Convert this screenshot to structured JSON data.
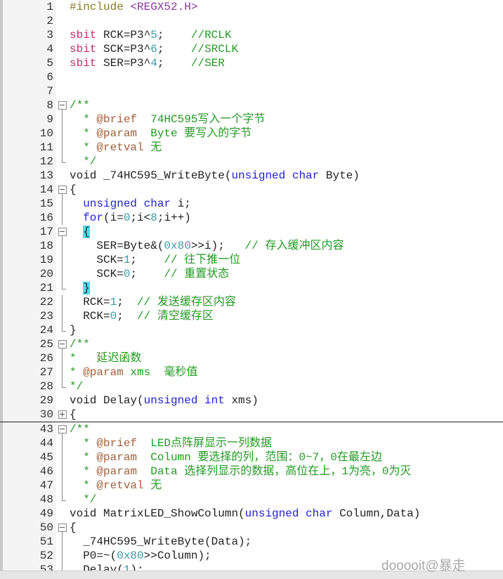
{
  "editor": {
    "lines": [
      {
        "n": "1",
        "fold": "none",
        "tokens": [
          [
            "p",
            "#include "
          ],
          [
            "str",
            "<REGX52.H>"
          ]
        ]
      },
      {
        "n": "2",
        "fold": "none",
        "tokens": []
      },
      {
        "n": "3",
        "fold": "none",
        "tokens": [
          [
            "s",
            "sbit "
          ],
          [
            "t",
            "RCK=P3^"
          ],
          [
            "n",
            "5"
          ],
          [
            "t",
            ";    "
          ],
          [
            "c",
            "//RCLK"
          ]
        ]
      },
      {
        "n": "4",
        "fold": "none",
        "tokens": [
          [
            "s",
            "sbit "
          ],
          [
            "t",
            "SCK=P3^"
          ],
          [
            "n",
            "6"
          ],
          [
            "t",
            ";    "
          ],
          [
            "c",
            "//SRCLK"
          ]
        ]
      },
      {
        "n": "5",
        "fold": "none",
        "tokens": [
          [
            "s",
            "sbit "
          ],
          [
            "t",
            "SER=P3^"
          ],
          [
            "n",
            "4"
          ],
          [
            "t",
            ";    "
          ],
          [
            "c",
            "//SER"
          ]
        ]
      },
      {
        "n": "6",
        "fold": "none",
        "tokens": []
      },
      {
        "n": "7",
        "fold": "none",
        "tokens": []
      },
      {
        "n": "8",
        "fold": "minus",
        "tokens": [
          [
            "c",
            "/**"
          ]
        ]
      },
      {
        "n": "9",
        "fold": "bar",
        "tokens": [
          [
            "c",
            "  * "
          ],
          [
            "d",
            "@brief"
          ],
          [
            "c",
            "  74HC595写入一个字节"
          ]
        ]
      },
      {
        "n": "10",
        "fold": "bar",
        "tokens": [
          [
            "c",
            "  * "
          ],
          [
            "d",
            "@param"
          ],
          [
            "c",
            "  Byte 要写入的字节"
          ]
        ]
      },
      {
        "n": "11",
        "fold": "bar",
        "tokens": [
          [
            "c",
            "  * "
          ],
          [
            "d",
            "@retval"
          ],
          [
            "c",
            " 无"
          ]
        ]
      },
      {
        "n": "12",
        "fold": "end",
        "tokens": [
          [
            "c",
            "  */"
          ]
        ]
      },
      {
        "n": "13",
        "fold": "none",
        "tokens": [
          [
            "t",
            "void _74HC595_WriteByte("
          ],
          [
            "k",
            "unsigned char"
          ],
          [
            "t",
            " Byte)"
          ]
        ]
      },
      {
        "n": "14",
        "fold": "minus",
        "tokens": [
          [
            "t",
            "{"
          ]
        ]
      },
      {
        "n": "15",
        "fold": "bar",
        "tokens": [
          [
            "t",
            "  "
          ],
          [
            "k",
            "unsigned char"
          ],
          [
            "t",
            " i;"
          ]
        ]
      },
      {
        "n": "16",
        "fold": "bar",
        "tokens": [
          [
            "t",
            "  "
          ],
          [
            "k",
            "for"
          ],
          [
            "t",
            "(i="
          ],
          [
            "n",
            "0"
          ],
          [
            "t",
            ";i<"
          ],
          [
            "n",
            "8"
          ],
          [
            "t",
            ";i++)"
          ]
        ]
      },
      {
        "n": "17",
        "fold": "minus",
        "tokens": [
          [
            "t",
            "  "
          ],
          [
            "h",
            "{"
          ]
        ]
      },
      {
        "n": "18",
        "fold": "bar",
        "tokens": [
          [
            "t",
            "    SER=Byte&("
          ],
          [
            "n",
            "0x80"
          ],
          [
            "t",
            ">>i);   "
          ],
          [
            "c",
            "// 存入缓冲区内容"
          ]
        ]
      },
      {
        "n": "19",
        "fold": "bar",
        "tokens": [
          [
            "t",
            "    SCK="
          ],
          [
            "n",
            "1"
          ],
          [
            "t",
            ";    "
          ],
          [
            "c",
            "// 往下推一位"
          ]
        ]
      },
      {
        "n": "20",
        "fold": "bar",
        "tokens": [
          [
            "t",
            "    SCK="
          ],
          [
            "n",
            "0"
          ],
          [
            "t",
            ";    "
          ],
          [
            "c",
            "// 重置状态"
          ]
        ]
      },
      {
        "n": "21",
        "fold": "end",
        "tokens": [
          [
            "t",
            "  "
          ],
          [
            "h",
            "}"
          ]
        ]
      },
      {
        "n": "22",
        "fold": "bar",
        "tokens": [
          [
            "t",
            "  RCK="
          ],
          [
            "n",
            "1"
          ],
          [
            "t",
            ";  "
          ],
          [
            "c",
            "// 发送缓存区内容"
          ]
        ]
      },
      {
        "n": "23",
        "fold": "bar",
        "tokens": [
          [
            "t",
            "  RCK="
          ],
          [
            "n",
            "0"
          ],
          [
            "t",
            ";  "
          ],
          [
            "c",
            "// 清空缓存区"
          ]
        ]
      },
      {
        "n": "24",
        "fold": "end",
        "tokens": [
          [
            "t",
            "}"
          ]
        ]
      },
      {
        "n": "25",
        "fold": "minus",
        "tokens": [
          [
            "c",
            "/**"
          ]
        ]
      },
      {
        "n": "26",
        "fold": "bar",
        "tokens": [
          [
            "c",
            "*   延迟函数"
          ]
        ]
      },
      {
        "n": "27",
        "fold": "bar",
        "tokens": [
          [
            "c",
            "* "
          ],
          [
            "d",
            "@param"
          ],
          [
            "c",
            " xms  毫秒值"
          ]
        ]
      },
      {
        "n": "28",
        "fold": "end",
        "tokens": [
          [
            "c",
            "*/"
          ]
        ]
      },
      {
        "n": "29",
        "fold": "none",
        "tokens": [
          [
            "t",
            "void Delay("
          ],
          [
            "k",
            "unsigned int"
          ],
          [
            "t",
            " xms)"
          ]
        ]
      },
      {
        "n": "30",
        "fold": "plus",
        "sep": true,
        "tokens": [
          [
            "t",
            "{"
          ]
        ]
      },
      {
        "n": "43",
        "fold": "minus",
        "tokens": [
          [
            "c",
            "/**"
          ]
        ]
      },
      {
        "n": "44",
        "fold": "bar",
        "tokens": [
          [
            "c",
            "  * "
          ],
          [
            "d",
            "@brief"
          ],
          [
            "c",
            "  LED点阵屏显示一列数据"
          ]
        ]
      },
      {
        "n": "45",
        "fold": "bar",
        "tokens": [
          [
            "c",
            "  * "
          ],
          [
            "d",
            "@param"
          ],
          [
            "c",
            "  Column 要选择的列，范围：0~7，0在最左边"
          ]
        ]
      },
      {
        "n": "46",
        "fold": "bar",
        "tokens": [
          [
            "c",
            "  * "
          ],
          [
            "d",
            "@param"
          ],
          [
            "c",
            "  Data 选择列显示的数据，高位在上，1为亮，0为灭"
          ]
        ]
      },
      {
        "n": "47",
        "fold": "bar",
        "tokens": [
          [
            "c",
            "  * "
          ],
          [
            "d",
            "@retval"
          ],
          [
            "c",
            " 无"
          ]
        ]
      },
      {
        "n": "48",
        "fold": "end",
        "tokens": [
          [
            "c",
            "  */"
          ]
        ]
      },
      {
        "n": "49",
        "fold": "none",
        "tokens": [
          [
            "t",
            "void MatrixLED_ShowColumn("
          ],
          [
            "k",
            "unsigned char"
          ],
          [
            "t",
            " Column,Data)"
          ]
        ]
      },
      {
        "n": "50",
        "fold": "minus",
        "tokens": [
          [
            "t",
            "{"
          ]
        ]
      },
      {
        "n": "51",
        "fold": "bar",
        "tokens": [
          [
            "t",
            "  _74HC595_WriteByte(Data);"
          ]
        ]
      },
      {
        "n": "52",
        "fold": "bar",
        "tokens": [
          [
            "t",
            "  P0=~("
          ],
          [
            "n",
            "0x80"
          ],
          [
            "t",
            ">>Column);"
          ]
        ]
      },
      {
        "n": "53",
        "fold": "bar",
        "tokens": [
          [
            "t",
            "  Delay("
          ],
          [
            "n",
            "1"
          ],
          [
            "t",
            ");"
          ]
        ]
      }
    ]
  },
  "watermark": "dooooit@暴走"
}
